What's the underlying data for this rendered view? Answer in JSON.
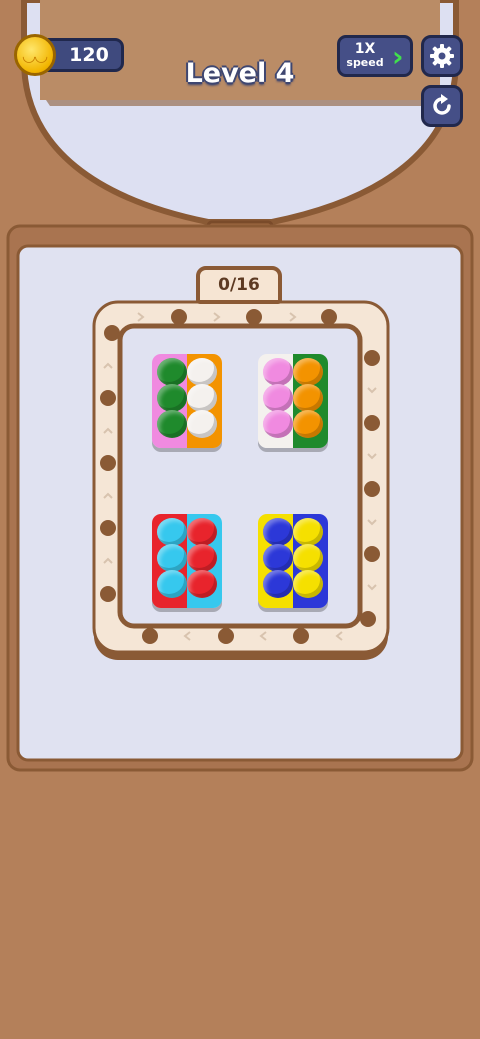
{
  "hud": {
    "coins": "120",
    "level_title": "Level 4",
    "speed_multiplier": "1X",
    "speed_label": "speed"
  },
  "board": {
    "progress": "0/16"
  },
  "colors": {
    "green": "#1f8a2c",
    "white": "#f4f1ee",
    "pink": "#f08ae0",
    "orange": "#f39300",
    "cyan": "#36c8ee",
    "red": "#e8242c",
    "blue": "#2c38d8",
    "yellow": "#f5e000"
  },
  "trays": [
    {
      "name": "tray-top-left",
      "left_color": "#f08ae0",
      "right_color": "#f39300",
      "balls": [
        [
          "#1f8a2c",
          "#f4f1ee"
        ],
        [
          "#1f8a2c",
          "#f4f1ee"
        ],
        [
          "#1f8a2c",
          "#f4f1ee"
        ]
      ]
    },
    {
      "name": "tray-top-right",
      "left_color": "#f4f1ee",
      "right_color": "#1f8a2c",
      "balls": [
        [
          "#f08ae0",
          "#f39300"
        ],
        [
          "#f08ae0",
          "#f39300"
        ],
        [
          "#f08ae0",
          "#f39300"
        ]
      ]
    },
    {
      "name": "tray-bottom-left",
      "left_color": "#e8242c",
      "right_color": "#36c8ee",
      "balls": [
        [
          "#36c8ee",
          "#e8242c"
        ],
        [
          "#36c8ee",
          "#e8242c"
        ],
        [
          "#36c8ee",
          "#e8242c"
        ]
      ]
    },
    {
      "name": "tray-bottom-right",
      "left_color": "#f5e000",
      "right_color": "#2c38d8",
      "balls": [
        [
          "#2c38d8",
          "#f5e000"
        ],
        [
          "#2c38d8",
          "#f5e000"
        ],
        [
          "#2c38d8",
          "#f5e000"
        ]
      ]
    }
  ]
}
